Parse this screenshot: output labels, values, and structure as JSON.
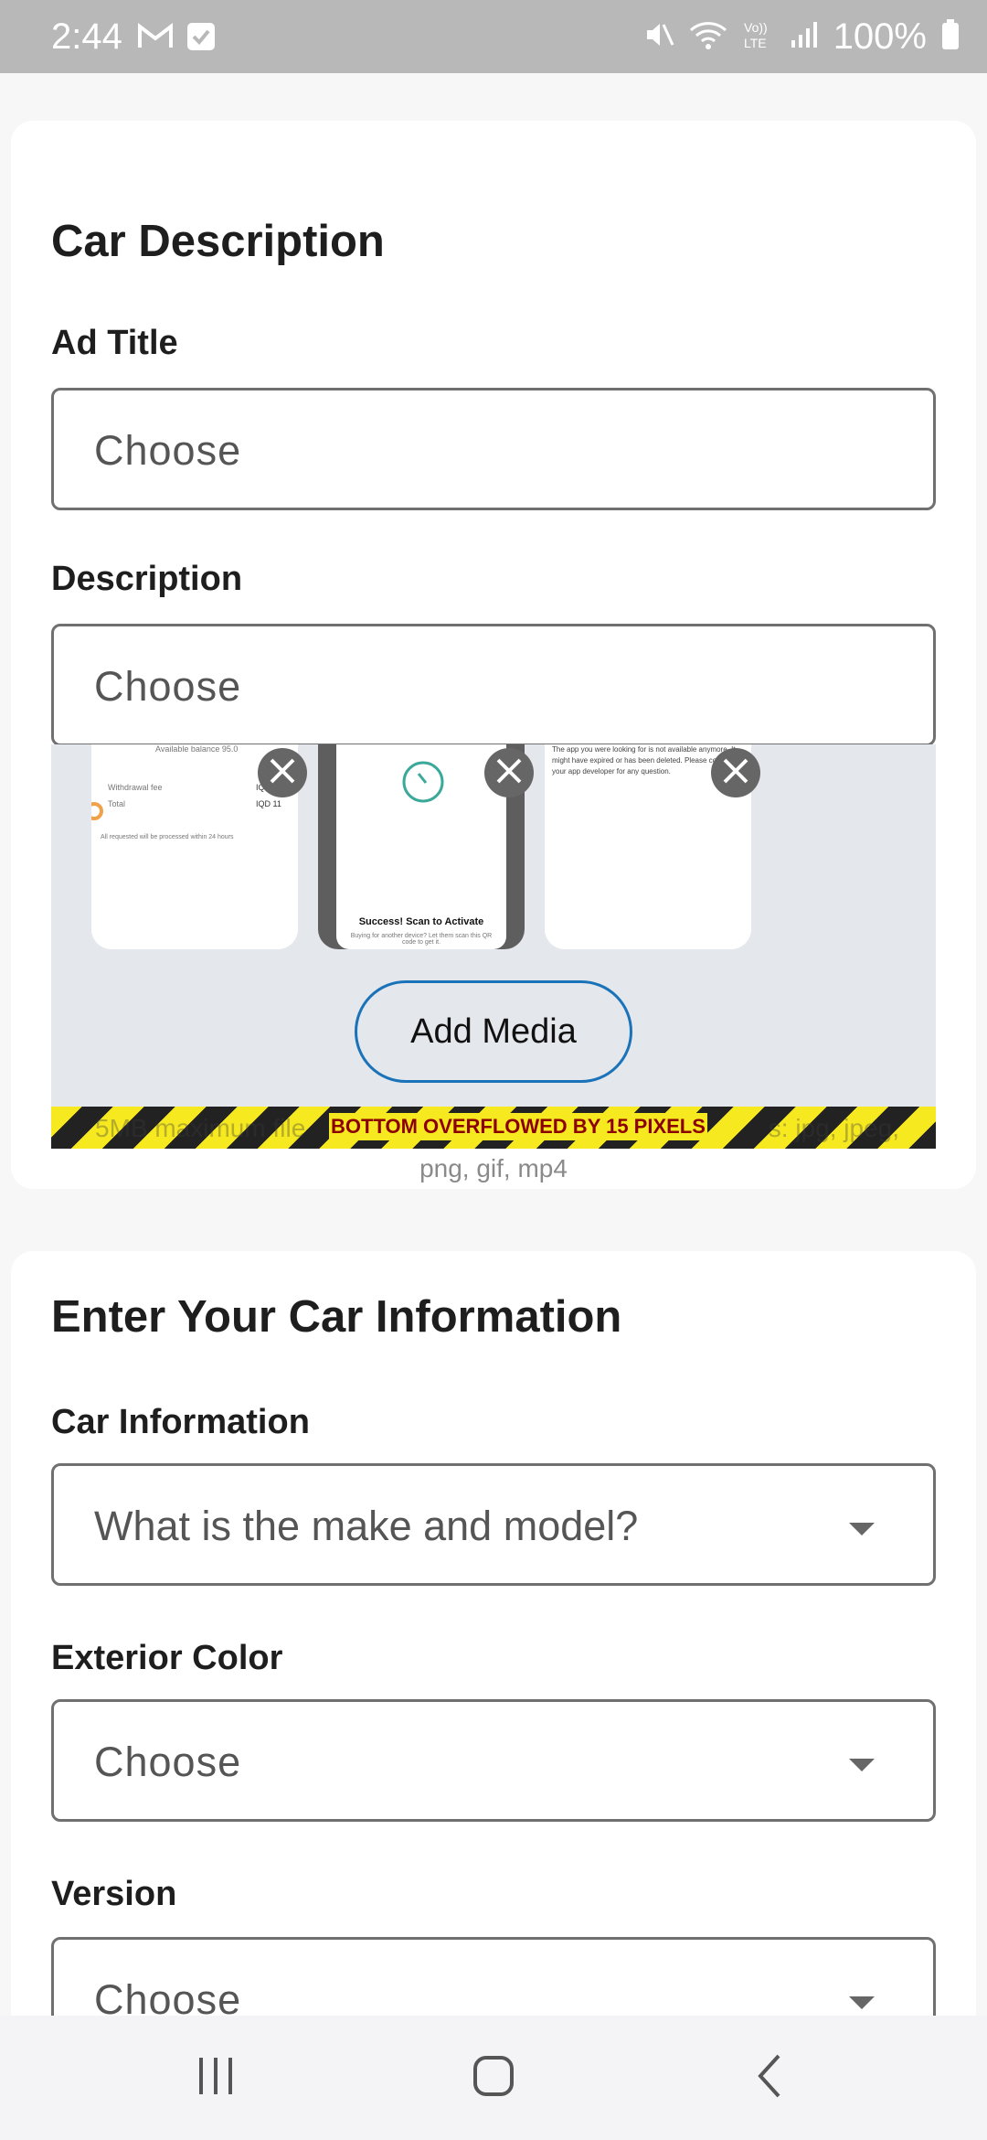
{
  "status": {
    "time": "2:44",
    "battery": "100%",
    "network_label": "VoLTE"
  },
  "car_description": {
    "title": "Car Description",
    "ad_title_label": "Ad Title",
    "ad_title_placeholder": "Choose",
    "description_label": "Description",
    "description_placeholder": "Choose"
  },
  "media": {
    "add_button": "Add Media",
    "thumbnails": [
      {
        "line1": "Available balance 95.0",
        "line2": "Withdrawal fee",
        "line2_value": "IQD 1",
        "line3": "Total",
        "line3_value": "IQD 11",
        "line4": "All requested will be processed within 24 hours"
      },
      {
        "title": "Success! Scan to Activate",
        "subtitle": "Buying for another device? Let them scan this QR code to get it."
      },
      {
        "text": "The app you were looking for is not available anymore. It might have expired or has been deleted. Please contact your app developer for any question."
      }
    ],
    "overflow_message": "BOTTOM OVERFLOWED BY 15 PIXELS",
    "hidden_left_text": "5MB maximum file",
    "hidden_right_text": "s: jpg, jpeg,",
    "formats": "png, gif, mp4"
  },
  "car_info": {
    "title": "Enter Your Car Information",
    "car_information_label": "Car Information",
    "car_information_placeholder": "What is the make and model?",
    "exterior_color_label": "Exterior Color",
    "exterior_color_placeholder": "Choose",
    "version_label": "Version",
    "version_placeholder": "Choose"
  },
  "colors": {
    "accent_outline": "#1a73b8",
    "overflow_text": "#8b0000",
    "stripe_yellow": "#f6e91f",
    "progress_teal": "#3aa99a"
  },
  "icons": [
    "gmail-icon",
    "check-box-icon",
    "mute-icon",
    "wifi-icon",
    "volte-icon",
    "signal-icon",
    "battery-icon",
    "close-icon",
    "recent-apps-icon",
    "home-icon",
    "back-icon"
  ]
}
